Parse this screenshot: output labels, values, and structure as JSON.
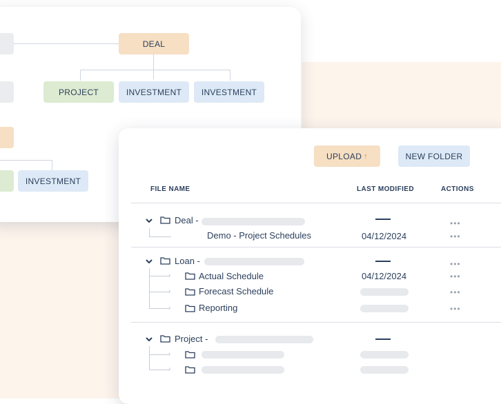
{
  "tree": {
    "nodes": {
      "deal": "DEAL",
      "project": "PROJECT",
      "investment_1": "INVESTMENT",
      "investment_2": "INVESTMENT",
      "investment_left": "INVESTMENT"
    }
  },
  "toolbar": {
    "upload_label": "UPLOAD",
    "upload_arrow": "↑",
    "new_folder_label": "NEW FOLDER"
  },
  "table": {
    "headers": {
      "file_name": "FILE NAME",
      "last_modified": "LAST MODIFIED",
      "actions": "ACTIONS"
    },
    "groups": [
      {
        "name": "Deal -",
        "children": [
          {
            "name": "Demo - Project Schedules",
            "date": "04/12/2024",
            "is_folder": false
          }
        ]
      },
      {
        "name": "Loan -",
        "children": [
          {
            "name": "Actual Schedule",
            "date": "04/12/2024",
            "is_folder": true
          },
          {
            "name": "Forecast Schedule",
            "date": "",
            "is_folder": true
          },
          {
            "name": "Reporting",
            "date": "",
            "is_folder": true
          }
        ]
      },
      {
        "name": "Project -",
        "children": []
      }
    ],
    "actions_glyph": "•••"
  },
  "colors": {
    "orange": "#f6dfc2",
    "green": "#dcebd1",
    "blue": "#dde9f6",
    "text": "#2b3f5c",
    "upload_arrow": "#e98a2c"
  }
}
